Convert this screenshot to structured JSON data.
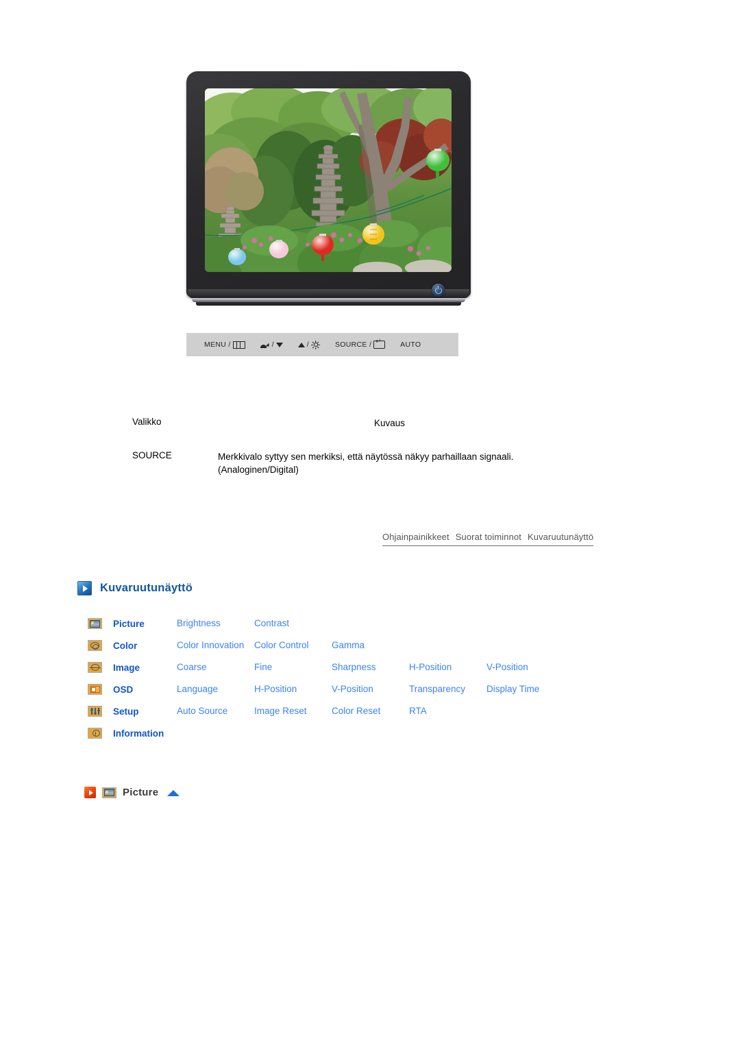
{
  "monitor": {
    "power_button": "power-button",
    "screen_image_alt": "garden-with-stone-pagoda-and-paper-lanterns"
  },
  "control_strip": {
    "items": [
      {
        "label": "MENU /",
        "icon": "menu-bars-icon"
      },
      {
        "label": "/",
        "icon_left": "volume-icon",
        "icon_right": "down-triangle-icon"
      },
      {
        "label": "/",
        "icon_left": "up-triangle-icon",
        "icon_right": "brightness-sun-icon"
      },
      {
        "label": "SOURCE /",
        "icon": "enter-key-icon"
      },
      {
        "label": "AUTO",
        "icon": ""
      }
    ]
  },
  "desc_table": {
    "header": {
      "menu": "Valikko",
      "description": "Kuvaus"
    },
    "rows": [
      {
        "menu": "SOURCE",
        "description_line1": "Merkkivalo syttyy sen merkiksi, että näytössä näkyy parhaillaan signaali.",
        "description_line2": "(Analoginen/Digital)"
      }
    ]
  },
  "breadcrumb": {
    "items": [
      "Ohjainpainikkeet",
      "Suorat toiminnot",
      "Kuvaruutunäyttö"
    ]
  },
  "section": {
    "title": "Kuvaruutunäyttö"
  },
  "osd_menu": {
    "rows": [
      {
        "icon": "picture-icon",
        "category": "Picture",
        "items": [
          "Brightness",
          "Contrast"
        ]
      },
      {
        "icon": "color-icon",
        "category": "Color",
        "items": [
          "Color Innovation",
          "Color Control",
          "Gamma"
        ]
      },
      {
        "icon": "image-icon",
        "category": "Image",
        "items": [
          "Coarse",
          "Fine",
          "Sharpness",
          "H-Position",
          "V-Position"
        ]
      },
      {
        "icon": "osd-icon",
        "category": "OSD",
        "items": [
          "Language",
          "H-Position",
          "V-Position",
          "Transparency",
          "Display Time"
        ]
      },
      {
        "icon": "setup-icon",
        "category": "Setup",
        "items": [
          "Auto Source",
          "Image Reset",
          "Color Reset",
          "RTA"
        ]
      },
      {
        "icon": "information-icon",
        "category": "Information",
        "items": []
      }
    ]
  },
  "picture_subheading": {
    "label": "Picture"
  },
  "colors": {
    "category_blue": "#1155cc",
    "item_blue": "#3b82f6",
    "heading_blue": "#12569c",
    "icon_orange": "#f0a32a",
    "red_arrow": "#e8400f",
    "control_strip_bg": "#cfcfcf"
  }
}
